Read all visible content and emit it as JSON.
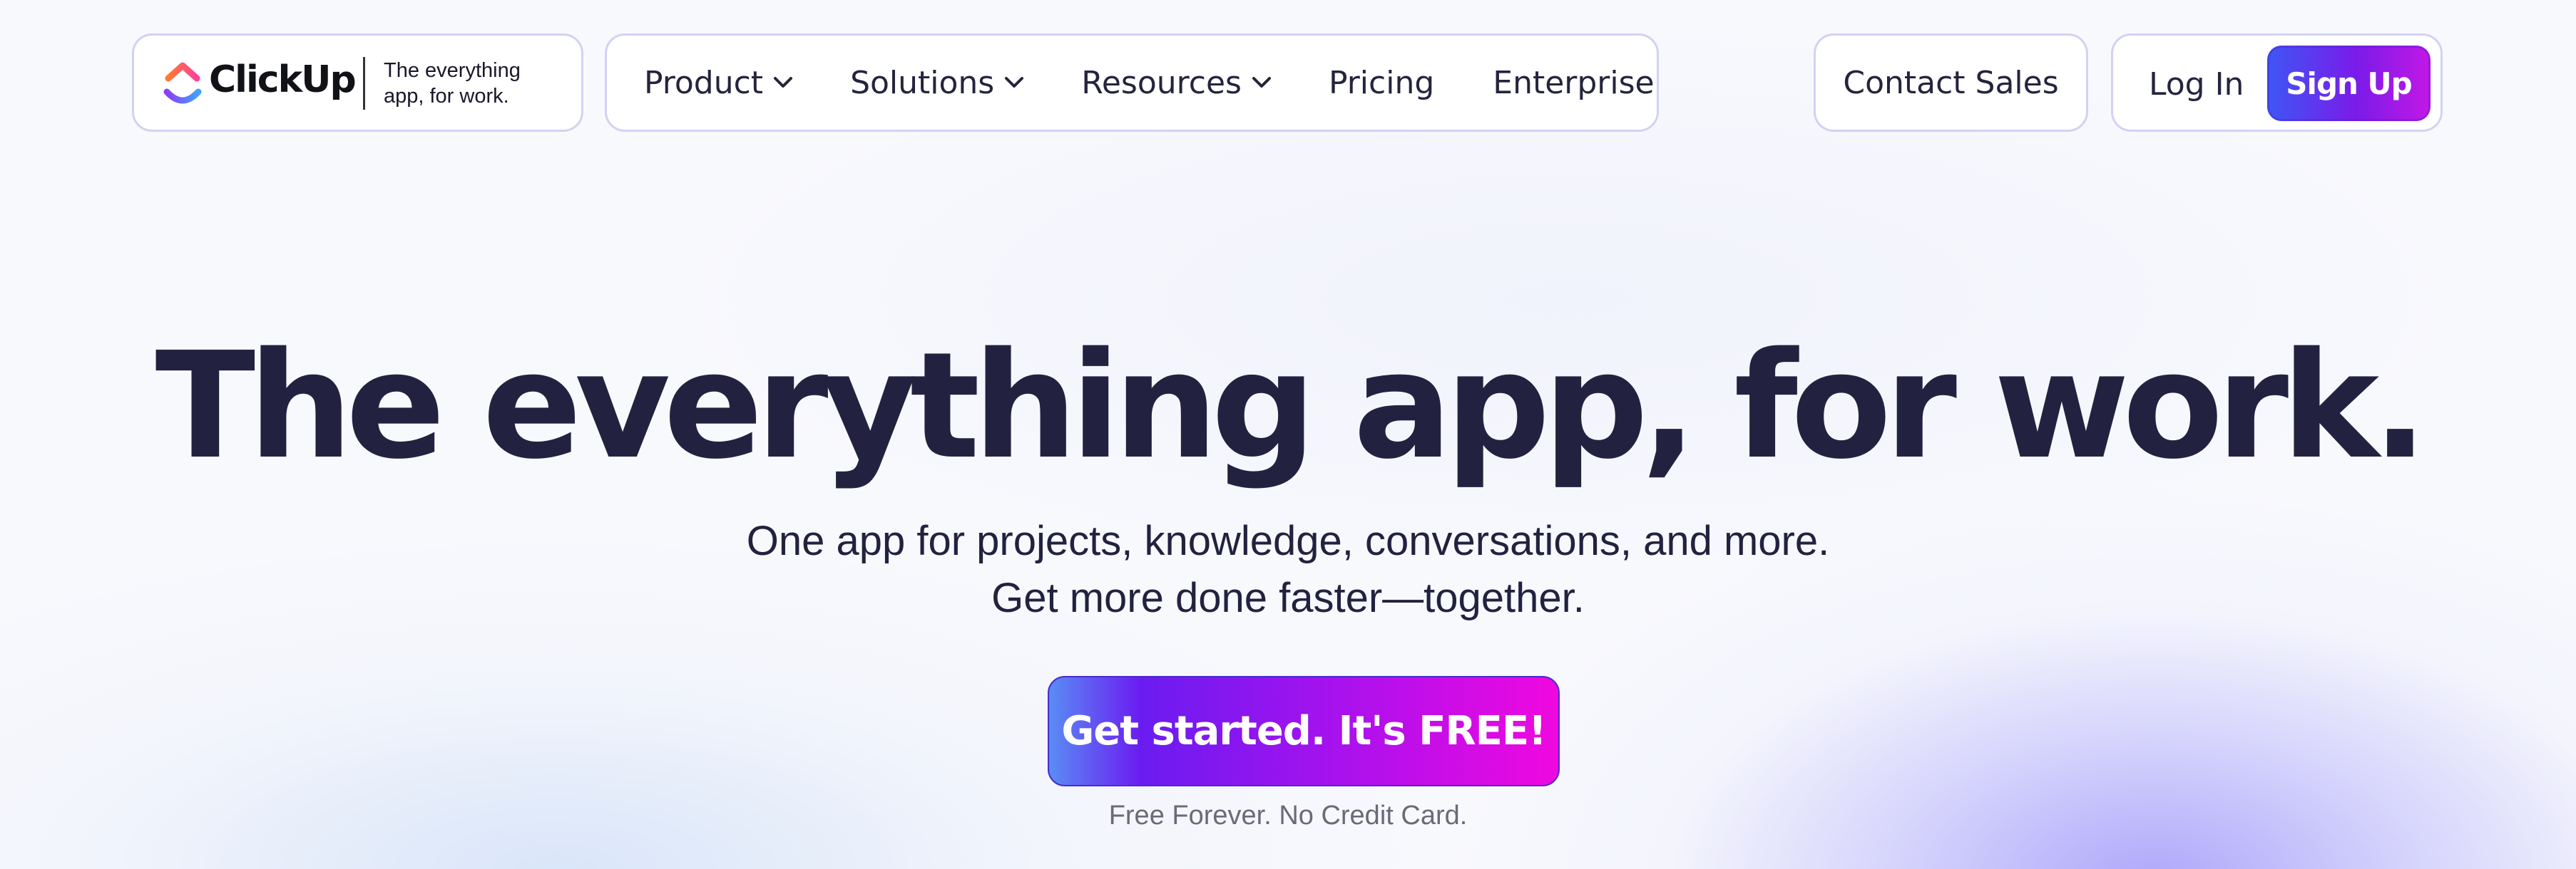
{
  "brand": {
    "name": "ClickUp",
    "tagline_line1": "The everything",
    "tagline_line2": "app, for work."
  },
  "nav": {
    "items": [
      {
        "label": "Product",
        "has_dropdown": true
      },
      {
        "label": "Solutions",
        "has_dropdown": true
      },
      {
        "label": "Resources",
        "has_dropdown": true
      },
      {
        "label": "Pricing",
        "has_dropdown": false
      },
      {
        "label": "Enterprise",
        "has_dropdown": false
      }
    ],
    "contact_sales": "Contact Sales",
    "login": "Log In",
    "signup": "Sign Up"
  },
  "hero": {
    "title": "The everything app, for work.",
    "subtitle_line1": "One app for projects, knowledge, conversations, and more.",
    "subtitle_line2": "Get more done faster—together.",
    "cta": "Get started. It's FREE!",
    "cta_note": "Free Forever. No Credit Card."
  },
  "colors": {
    "text_dark": "#222240",
    "border": "#d3d1f3",
    "signup_gradient": [
      "#3d57f5",
      "#7b1be9",
      "#c318e5"
    ],
    "cta_gradient": [
      "#5a8cf5",
      "#6a1cf0",
      "#a512ee",
      "#f008df"
    ]
  },
  "icons": {
    "logo": "clickup-logo-icon",
    "dropdown": "chevron-down-icon"
  }
}
